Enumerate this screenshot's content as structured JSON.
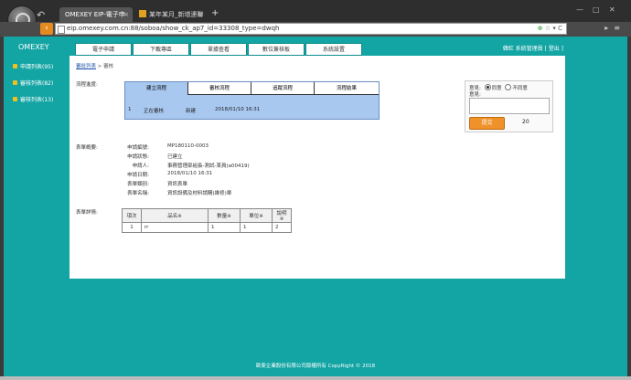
{
  "browser": {
    "tabs": [
      {
        "label": "OMEXEY EIP-電子申",
        "active": true
      },
      {
        "label": "某年某月_新增連聯",
        "active": false
      }
    ],
    "url": "eip.omexey.com.cn:88/soboa/show_ck_ap7_id=33308_type=dwqh",
    "badge": "20"
  },
  "app": {
    "brand": "OMEXEY",
    "nav": [
      "電子申請",
      "下載專區",
      "單據查看",
      "數位簽核板",
      "系統設置"
    ],
    "user_text": "韓紅 系統管理員 [ 登出 ]",
    "sidebar": [
      {
        "label": "申請列表(95)"
      },
      {
        "label": "審核列表(82)"
      },
      {
        "label": "審核列表(13)"
      }
    ],
    "breadcrumb": {
      "link": "審批列表",
      "sep": ">",
      "current": "審核"
    },
    "flow_label": "流程進度:",
    "flow_cols": [
      "建立流程",
      "審核流程",
      "追蹤流程",
      "流程結果"
    ],
    "flow_row": {
      "step": "1",
      "status": "正在審核",
      "action": "新建",
      "time": "2018/01/10 16:31"
    },
    "sign": {
      "opinion_label": "意見:",
      "agree": "同意",
      "disagree": "不同意",
      "note_label": "意見:",
      "submit": "提交",
      "count": "20"
    },
    "form_label": "表單概要:",
    "info": [
      {
        "k": "申請編號:",
        "v": "MP180110-0003"
      },
      {
        "k": "申請狀態:",
        "v": "已建立"
      },
      {
        "k": "申請人:",
        "v": "事務管理部組長-測試-某員(a00419)"
      },
      {
        "k": "申請日期:",
        "v": "2018/01/10 16:31"
      },
      {
        "k": "表單類別:",
        "v": "資訊表單"
      },
      {
        "k": "表單名稱:",
        "v": "資訊設備及材料請購(維修)單"
      }
    ],
    "detail_label": "表單詳情:",
    "detail_headers": [
      "項次",
      "品名※",
      "數量※",
      "單位※",
      "說明※"
    ],
    "detail_rows": [
      [
        "1",
        "rr",
        "1",
        "1",
        "2"
      ]
    ],
    "footer": "歐斐企業股份有限公司版權所有 CopyRight © 2018"
  }
}
